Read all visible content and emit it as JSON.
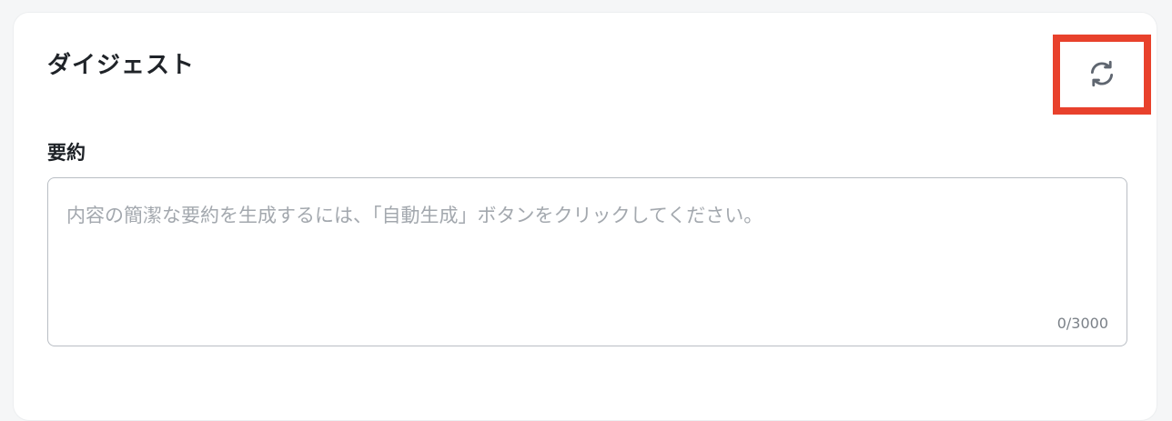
{
  "digest": {
    "title": "ダイジェスト",
    "refresh_icon": "refresh-icon",
    "highlight_color": "#e8412c"
  },
  "summary": {
    "label": "要約",
    "value": "",
    "placeholder": "内容の簡潔な要約を生成するには、「自動生成」ボタンをクリックしてください。",
    "counter": "0/3000"
  }
}
